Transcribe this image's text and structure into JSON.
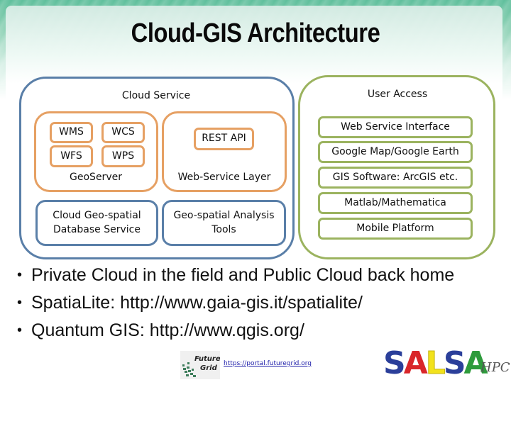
{
  "title": "Cloud-GIS Architecture",
  "cloud_service": {
    "label": "Cloud Service",
    "geoserver": {
      "label": "GeoServer",
      "services": [
        "WMS",
        "WCS",
        "WFS",
        "WPS"
      ]
    },
    "web_service_layer": {
      "label": "Web-Service Layer",
      "rest_api": "REST API"
    },
    "database_service": "Cloud Geo-spatial\nDatabase Service",
    "analysis_tools": "Geo-spatial Analysis\nTools"
  },
  "user_access": {
    "label": "User Access",
    "items": [
      "Web Service Interface",
      "Google Map/Google Earth",
      "GIS Software: ArcGIS etc.",
      "Matlab/Mathematica",
      "Mobile Platform"
    ]
  },
  "bullets": [
    "Private Cloud in the field and Public Cloud back home",
    "SpatiaLite: http://www.gaia-gis.it/spatialite/",
    "Quantum GIS: http://www.qgis.org/"
  ],
  "footer": {
    "futuregrid_logo_text": [
      "Future",
      "Grid"
    ],
    "futuregrid_link": "https://portal.futuregrid.org",
    "salsa_letters": [
      {
        "char": "S",
        "color": "#2b3f9a"
      },
      {
        "char": "A",
        "color": "#d9262a"
      },
      {
        "char": "L",
        "color": "#f2e21c"
      },
      {
        "char": "S",
        "color": "#2b3f9a"
      },
      {
        "char": "A",
        "color": "#2e9b3c"
      }
    ],
    "hpc_text": "HPC"
  },
  "colors": {
    "cloud_border": "#5a7fa8",
    "geoserver_border": "#e6a063",
    "user_access_border": "#9bb35f"
  }
}
